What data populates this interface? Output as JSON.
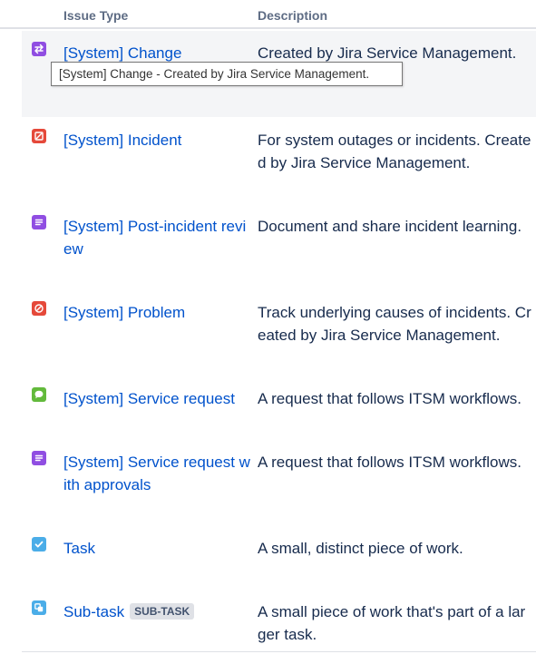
{
  "table": {
    "headers": {
      "issue_type": "Issue Type",
      "description": "Description"
    },
    "rows": [
      {
        "name": "[System] Change",
        "description": "Created by Jira Service Management.",
        "icon": "change-icon",
        "color": "#904ee2"
      },
      {
        "name": "[System] Incident",
        "description": "For system outages or incidents. Created by Jira Service Management.",
        "icon": "incident-icon",
        "color": "#e5493a"
      },
      {
        "name": "[System] Post-incident review",
        "description": "Document and share incident learning.",
        "icon": "post-incident-review-icon",
        "color": "#904ee2"
      },
      {
        "name": "[System] Problem",
        "description": "Track underlying causes of incidents. Created by Jira Service Management.",
        "icon": "problem-icon",
        "color": "#e5493a"
      },
      {
        "name": "[System] Service request",
        "description": "A request that follows ITSM workflows.",
        "icon": "service-request-icon",
        "color": "#63ba3c"
      },
      {
        "name": "[System] Service request with approvals",
        "description": "A request that follows ITSM workflows.",
        "icon": "service-request-approvals-icon",
        "color": "#904ee2"
      },
      {
        "name": "Task",
        "description": "A small, distinct piece of work.",
        "icon": "task-icon",
        "color": "#4bade8"
      },
      {
        "name": "Sub-task",
        "badge": "SUB-TASK",
        "description": "A small piece of work that's part of a larger task.",
        "icon": "subtask-icon",
        "color": "#4bade8"
      }
    ]
  },
  "tooltip": {
    "text": "[System] Change - Created by Jira Service Management."
  }
}
